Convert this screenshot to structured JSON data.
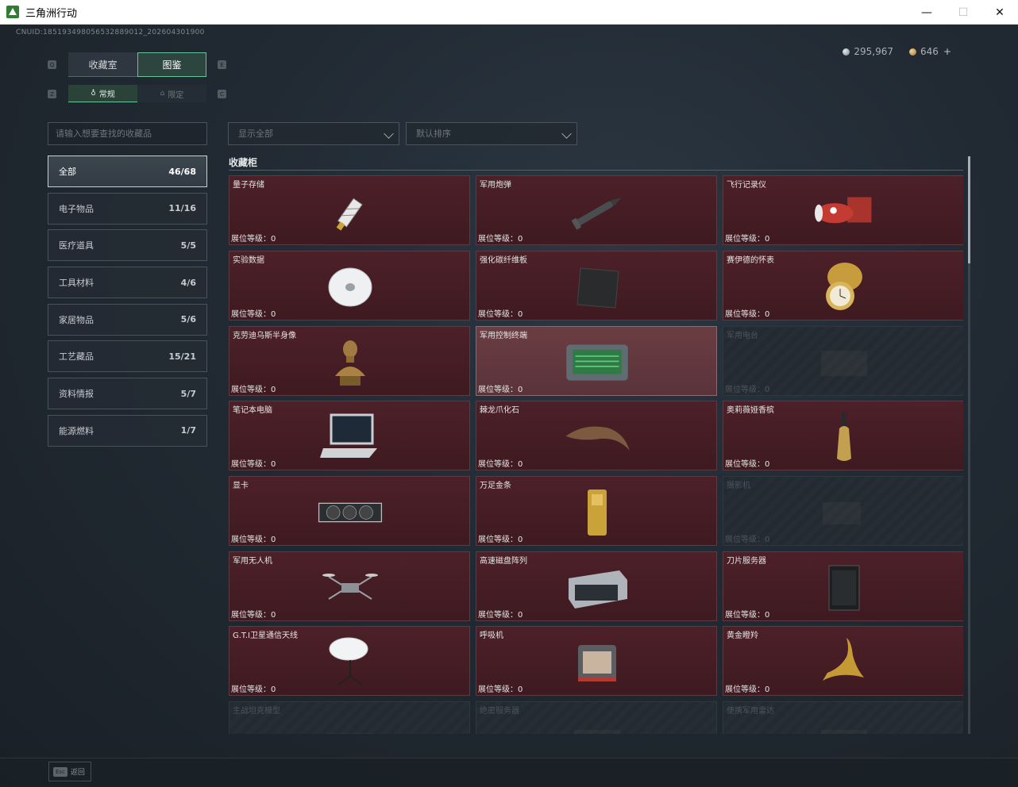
{
  "window": {
    "title": "三角洲行动",
    "minimize": "—",
    "maximize": "☐",
    "close": "✕"
  },
  "header": {
    "uid": "CNUID:185193498056532889012_202604301900",
    "currency": {
      "silver": "295,967",
      "gold": "646",
      "add": "+"
    }
  },
  "tabs": [
    {
      "label": "收藏室"
    },
    {
      "label": "图鉴"
    }
  ],
  "subtabs": [
    {
      "label": "常规",
      "icon": "♁"
    },
    {
      "label": "限定",
      "icon": "⌂"
    }
  ],
  "search": {
    "placeholder": "请输入想要查找的收藏品"
  },
  "filters": {
    "show": "显示全部",
    "sort": "默认排序"
  },
  "categories": [
    {
      "label": "全部",
      "count": "46/68"
    },
    {
      "label": "电子物品",
      "count": "11/16"
    },
    {
      "label": "医疗道具",
      "count": "5/5"
    },
    {
      "label": "工具材料",
      "count": "4/6"
    },
    {
      "label": "家居物品",
      "count": "5/6"
    },
    {
      "label": "工艺藏品",
      "count": "15/21"
    },
    {
      "label": "资料情报",
      "count": "5/7"
    },
    {
      "label": "能源燃料",
      "count": "1/7"
    }
  ],
  "cabinet": {
    "title": "收藏柜",
    "items": [
      {
        "name": "量子存储",
        "level": "展位等级：0",
        "icon": "usb-drive-icon",
        "state": "owned"
      },
      {
        "name": "军用炮弹",
        "level": "展位等级：0",
        "icon": "shell-icon",
        "state": "owned"
      },
      {
        "name": "飞行记录仪",
        "level": "展位等级：0",
        "icon": "flight-recorder-icon",
        "state": "owned"
      },
      {
        "name": "实验数据",
        "level": "展位等级：0",
        "icon": "disc-icon",
        "state": "owned"
      },
      {
        "name": "强化碳纤维板",
        "level": "展位等级：0",
        "icon": "carbon-plate-icon",
        "state": "owned"
      },
      {
        "name": "赛伊德的怀表",
        "level": "展位等级：0",
        "icon": "pocket-watch-icon",
        "state": "owned"
      },
      {
        "name": "克劳迪乌斯半身像",
        "level": "展位等级：0",
        "icon": "bust-icon",
        "state": "owned"
      },
      {
        "name": "军用控制终端",
        "level": "展位等级：0",
        "icon": "terminal-icon",
        "state": "highlight"
      },
      {
        "name": "军用电台",
        "level": "展位等级：0",
        "icon": "radio-icon",
        "state": "locked"
      },
      {
        "name": "笔记本电脑",
        "level": "展位等级：0",
        "icon": "laptop-icon",
        "state": "owned"
      },
      {
        "name": "棘龙爪化石",
        "level": "展位等级：0",
        "icon": "claw-fossil-icon",
        "state": "owned"
      },
      {
        "name": "奥莉薇娅香槟",
        "level": "展位等级：0",
        "icon": "champagne-icon",
        "state": "owned"
      },
      {
        "name": "显卡",
        "level": "展位等级：0",
        "icon": "graphics-card-icon",
        "state": "owned"
      },
      {
        "name": "万足金条",
        "level": "展位等级：0",
        "icon": "gold-bar-icon",
        "state": "owned"
      },
      {
        "name": "摄影机",
        "level": "展位等级：0",
        "icon": "camera-icon",
        "state": "locked"
      },
      {
        "name": "军用无人机",
        "level": "展位等级：0",
        "icon": "drone-icon",
        "state": "owned"
      },
      {
        "name": "高速磁盘阵列",
        "level": "展位等级：0",
        "icon": "disk-array-icon",
        "state": "owned"
      },
      {
        "name": "刀片服务器",
        "level": "展位等级：0",
        "icon": "blade-server-icon",
        "state": "owned"
      },
      {
        "name": "G.T.I卫星通信天线",
        "level": "展位等级：0",
        "icon": "satellite-dish-icon",
        "state": "owned"
      },
      {
        "name": "呼吸机",
        "level": "展位等级：0",
        "icon": "ventilator-icon",
        "state": "owned"
      },
      {
        "name": "黄金瞪羚",
        "level": "展位等级：0",
        "icon": "gold-gazelle-icon",
        "state": "owned"
      },
      {
        "name": "主战坦克模型",
        "level": "",
        "icon": "tank-model-icon",
        "state": "locked"
      },
      {
        "name": "绝密服务器",
        "level": "",
        "icon": "server-icon",
        "state": "locked"
      },
      {
        "name": "便携军用雷达",
        "level": "",
        "icon": "radar-icon",
        "state": "locked"
      }
    ]
  },
  "footer": {
    "esc_key": "Esc",
    "esc_label": "返回"
  },
  "colors": {
    "accent": "#67c59a",
    "card_bg": "#4a1f27",
    "locked_bg": "#232a31"
  }
}
